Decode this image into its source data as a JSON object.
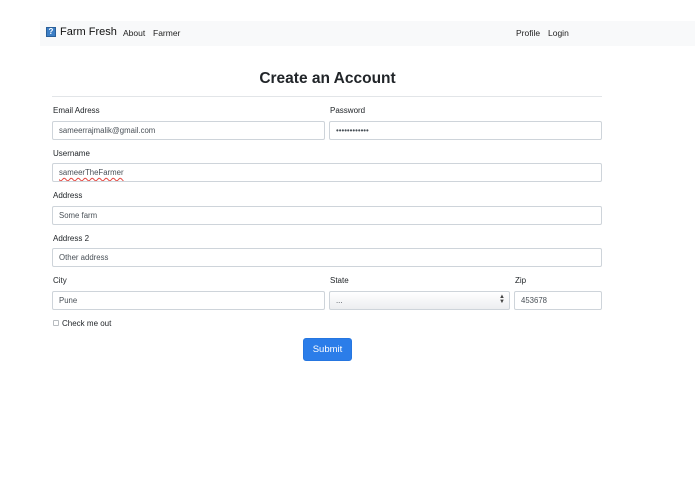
{
  "nav": {
    "brand": "Farm Fresh",
    "links": [
      "About",
      "Farmer"
    ],
    "right_links": [
      "Profile",
      "Login"
    ]
  },
  "form": {
    "title": "Create an Account",
    "email": {
      "label": "Email Adress",
      "value": "sameerrajmalik@gmail.com"
    },
    "password": {
      "label": "Password",
      "value": "••••••••••••"
    },
    "username": {
      "label": "Username",
      "value": "sameerTheFarmer"
    },
    "address": {
      "label": "Address",
      "value": "Some farm"
    },
    "address2": {
      "label": "Address 2",
      "value": "Other address"
    },
    "city": {
      "label": "City",
      "value": "Pune"
    },
    "state": {
      "label": "State",
      "value": "..."
    },
    "zip": {
      "label": "Zip",
      "value": "453678"
    },
    "checkbox_label": "Check me out",
    "submit_label": "Submit"
  },
  "colors": {
    "primary": "#2b7de9",
    "navbar_bg": "#f8f9fa"
  }
}
